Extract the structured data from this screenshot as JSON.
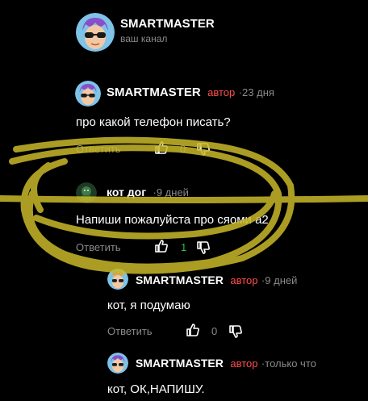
{
  "channel": {
    "name": "SMARTMASTER",
    "subtitle": "ваш канал"
  },
  "comments": [
    {
      "author": "SMARTMASTER",
      "badge": "автор",
      "sep": "·",
      "time": "23 дня",
      "text": "про какой телефон писать?",
      "reply_label": "Ответить",
      "likes": "0"
    },
    {
      "author": "кот дог",
      "sep": "·",
      "time": "9 дней",
      "text": "Напиши пожалуйста про сяоми а2",
      "reply_label": "Ответить",
      "likes": "1"
    },
    {
      "author": "SMARTMASTER",
      "badge": "автор",
      "sep": "·",
      "time": "9 дней",
      "text": "кот, я подумаю",
      "reply_label": "Ответить",
      "likes": "0"
    },
    {
      "author": "SMARTMASTER",
      "badge": "автор",
      "sep": "·",
      "time": "только что",
      "text": "кот, ОК,НАПИШУ."
    }
  ],
  "colors": {
    "background": "#000000",
    "author_badge": "#ff4d4d",
    "muted": "#8a8a8a",
    "like_active": "#2fbf4a",
    "scribble": "#c9b92a"
  },
  "icons": [
    "thumb-up-icon",
    "thumb-down-icon",
    "avatar-sunglasses-icon"
  ]
}
